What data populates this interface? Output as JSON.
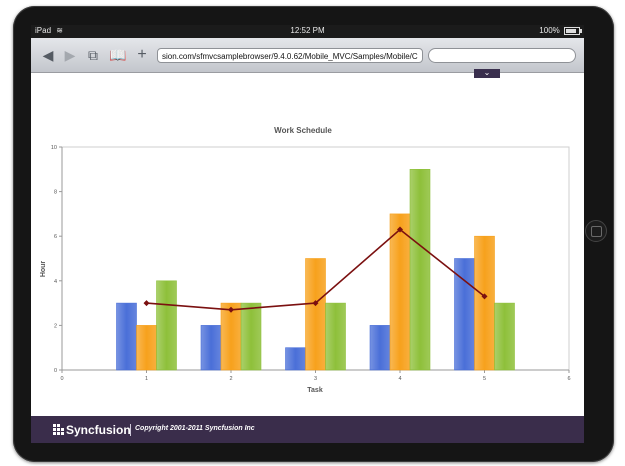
{
  "device": {
    "carrier": "iPad",
    "time": "12:52 PM",
    "battery": "100%"
  },
  "browser": {
    "url": "sion.com/sfmvcsamplebrowser/9.4.0.62/Mobile_MVC/Samples/Mobile/C",
    "search_placeholder": "",
    "dropdown_symbol": "⌄"
  },
  "icons": {
    "back": "back-arrow-icon",
    "forward": "forward-arrow-icon",
    "pages": "pages-icon",
    "bookmarks": "bookmarks-icon",
    "add": "add-icon",
    "wifi": "wifi-icon",
    "battery": "battery-icon",
    "logo": "syncfusion-logo-icon"
  },
  "footer": {
    "brand": "Syncfusion",
    "copyright": "Copyright 2001-2011 Syncfusion Inc"
  },
  "colors": {
    "series_blue": "#4a6fd8",
    "series_orange": "#f7a11c",
    "series_green": "#8ec03a",
    "line": "#7b1010",
    "footer_bg": "#3a2d4b"
  },
  "chart_data": {
    "type": "bar",
    "title": "Work Schedule",
    "xlabel": "Task",
    "ylabel": "Hour",
    "xlim": [
      0,
      6
    ],
    "ylim": [
      0,
      10
    ],
    "x_ticks": [
      "0",
      "1",
      "2",
      "3",
      "4",
      "5",
      "6"
    ],
    "y_ticks": [
      "0",
      "2",
      "4",
      "6",
      "8",
      "10"
    ],
    "categories": [
      "1",
      "2",
      "3",
      "4",
      "5"
    ],
    "series": [
      {
        "values": [
          3,
          2,
          1,
          2,
          5
        ],
        "color": "#4a6fd8"
      },
      {
        "values": [
          2,
          3,
          5,
          7,
          6
        ],
        "color": "#f7a11c"
      },
      {
        "values": [
          4,
          3,
          3,
          9,
          3
        ],
        "color": "#8ec03a"
      }
    ],
    "line_series": {
      "values": [
        3,
        2.7,
        3,
        6.3,
        3.3
      ],
      "color": "#7b1010"
    },
    "grid": false,
    "legend": "none"
  }
}
